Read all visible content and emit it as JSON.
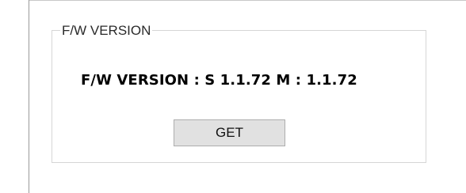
{
  "group": {
    "title": "F/W VERSION"
  },
  "version": {
    "text": "F/W VERSION : S 1.1.72 M : 1.1.72"
  },
  "actions": {
    "get_label": "GET"
  },
  "colors": {
    "button_face": "#e1e1e1",
    "button_border": "#adadad",
    "group_border": "#d6d6d6"
  }
}
